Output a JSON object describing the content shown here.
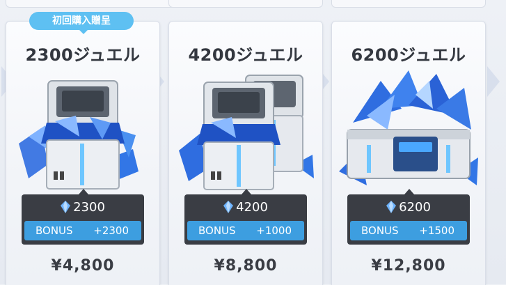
{
  "offers": [
    {
      "first_purchase_badge": "初回購入贈呈",
      "title": "2300ジュエル",
      "amount": "2300",
      "bonus_label": "BONUS",
      "bonus_value": "+2300",
      "price": "¥4,800"
    },
    {
      "title": "4200ジュエル",
      "amount": "4200",
      "bonus_label": "BONUS",
      "bonus_value": "+1000",
      "price": "¥8,800"
    },
    {
      "title": "6200ジュエル",
      "amount": "6200",
      "bonus_label": "BONUS",
      "bonus_value": "+1500",
      "price": "¥12,800"
    }
  ],
  "icons": {
    "currency": "blue-gem-icon"
  },
  "colors": {
    "accent_blue": "#3d9ee0",
    "badge_blue": "#5ec0f2",
    "info_dark": "#3a3d44",
    "title_text": "#33373f"
  }
}
